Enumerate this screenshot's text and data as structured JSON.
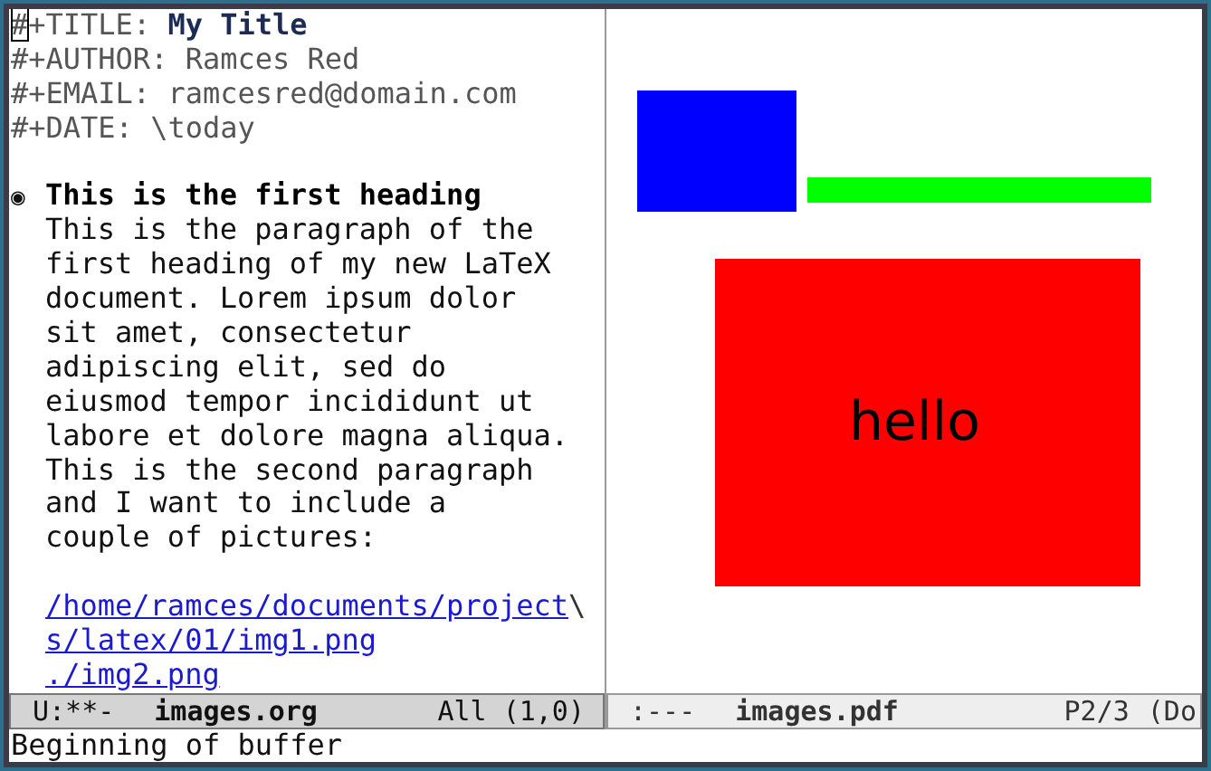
{
  "left_window": {
    "lines": [
      {
        "kind": "keyword",
        "key": "#+TITLE:",
        "value": "My Title",
        "emphasis": true,
        "cursor": true
      },
      {
        "kind": "keyword",
        "key": "#+AUTHOR:",
        "value": "Ramces Red",
        "emphasis": false,
        "cursor": false
      },
      {
        "kind": "keyword",
        "key": "#+EMAIL:",
        "value": "ramcesred@domain.com",
        "emphasis": false,
        "cursor": false
      },
      {
        "kind": "keyword",
        "key": "#+DATE:",
        "value": "\\today",
        "emphasis": false,
        "cursor": false
      },
      {
        "kind": "blank"
      },
      {
        "kind": "heading",
        "bullet": "◉",
        "text": "This is the first heading"
      },
      {
        "kind": "text",
        "text": "This is the paragraph of the"
      },
      {
        "kind": "text",
        "text": "first heading of my new LaTeX"
      },
      {
        "kind": "text",
        "text": "document. Lorem ipsum dolor"
      },
      {
        "kind": "text",
        "text": "sit amet, consectetur"
      },
      {
        "kind": "text",
        "text": "adipiscing elit, sed do"
      },
      {
        "kind": "text",
        "text": "eiusmod tempor incididunt ut"
      },
      {
        "kind": "text",
        "text": "labore et dolore magna aliqua."
      },
      {
        "kind": "text",
        "text": "This is the second paragraph"
      },
      {
        "kind": "text",
        "text": "and I want to include a"
      },
      {
        "kind": "text",
        "text": "couple of pictures:"
      },
      {
        "kind": "blank"
      },
      {
        "kind": "link",
        "text": "/home/ramces/documents/project",
        "continuation": "\\"
      },
      {
        "kind": "link",
        "text": "s/latex/01/img1.png"
      },
      {
        "kind": "link",
        "text": "./img2.png"
      }
    ],
    "mode_line": {
      "active": true,
      "status": "U:**-",
      "buffer": "images.org",
      "position": "All (1,0)"
    }
  },
  "right_window": {
    "figures": [
      {
        "kind": "rect",
        "color": "#0000ff"
      },
      {
        "kind": "bar",
        "color": "#00ff00"
      },
      {
        "kind": "box",
        "color": "#ff0000",
        "label": "hello"
      }
    ],
    "mode_line": {
      "active": false,
      "status": ":---",
      "buffer": "images.pdf",
      "position": "P2/3",
      "extra": "(Do"
    }
  },
  "echo_area": "Beginning of buffer"
}
